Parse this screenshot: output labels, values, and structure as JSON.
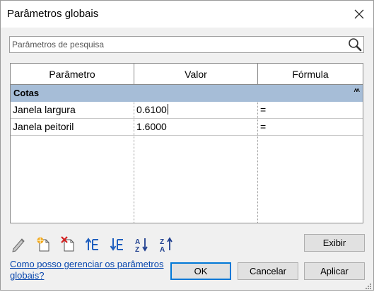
{
  "window": {
    "title": "Parâmetros globais"
  },
  "search": {
    "placeholder": "Parâmetros de pesquisa"
  },
  "table": {
    "headers": [
      "Parâmetro",
      "Valor",
      "Fórmula"
    ],
    "group": {
      "name": "Cotas"
    },
    "rows": [
      {
        "parameter": "Janela largura",
        "value": "0.6100",
        "formula": "="
      },
      {
        "parameter": "Janela peitoril",
        "value": "1.6000",
        "formula": "="
      }
    ]
  },
  "toolbar": {
    "icons": [
      "edit-pencil-icon",
      "new-parameter-icon",
      "delete-parameter-icon",
      "move-up-icon",
      "move-down-icon",
      "sort-ascending-icon",
      "sort-descending-icon"
    ]
  },
  "buttons": {
    "show": "Exibir",
    "ok": "OK",
    "cancel": "Cancelar",
    "apply": "Aplicar"
  },
  "help_link": "Como posso gerenciar os parâmetros globais?",
  "colors": {
    "group_header": "#a6bdd7",
    "link": "#0645ad",
    "default_button_border": "#0078d7"
  }
}
